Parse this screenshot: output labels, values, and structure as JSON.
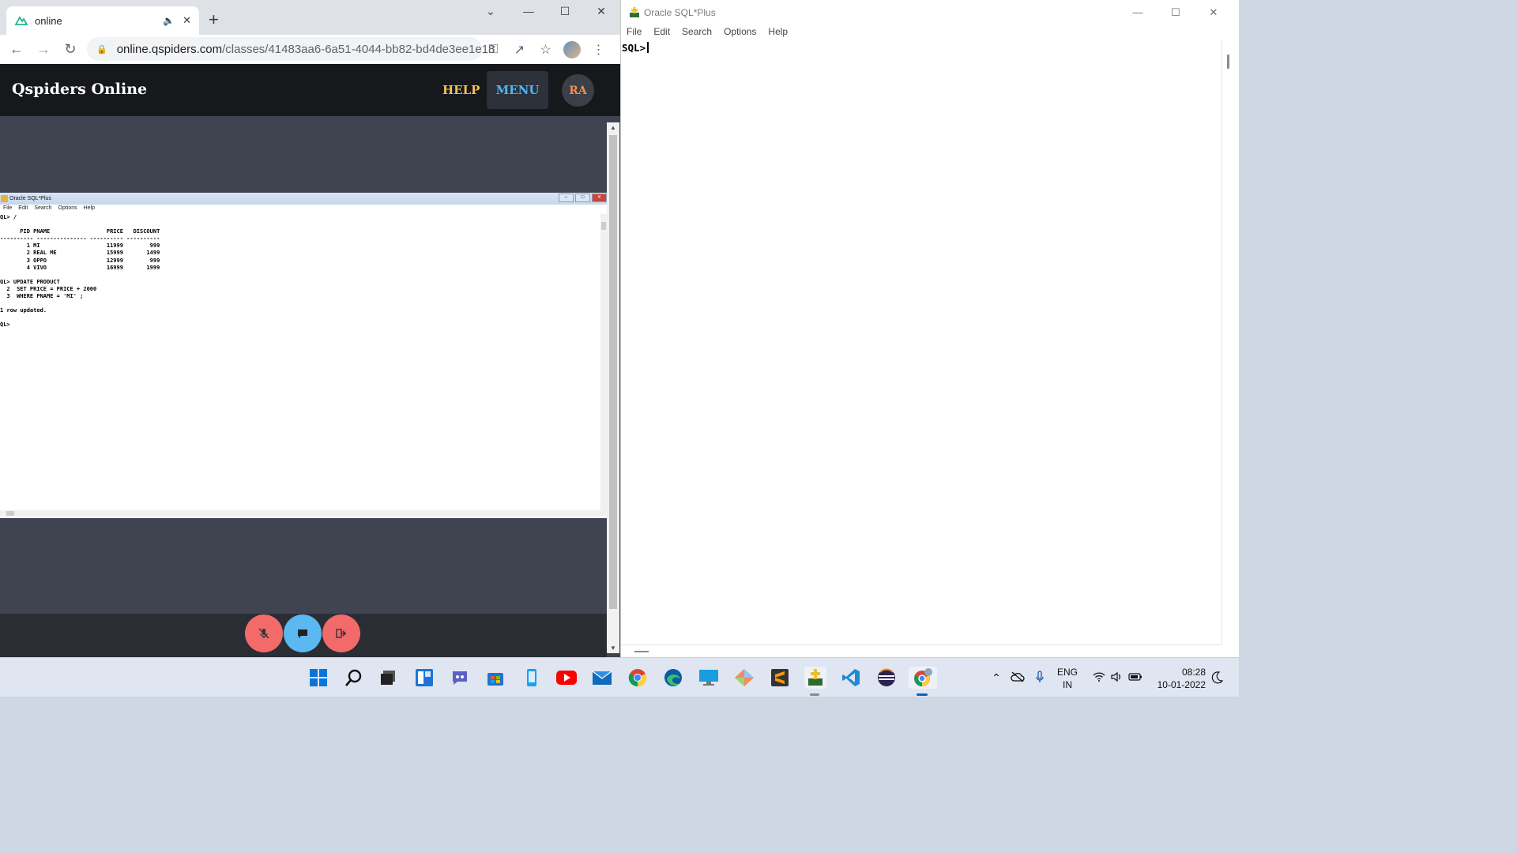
{
  "chrome": {
    "tab_title": "online",
    "url_host": "online.qspiders.com",
    "url_path": "/classes/41483aa6-6a51-4044-bb82-bd4de3ee1e18"
  },
  "site": {
    "brand": "Qspiders Online",
    "help": "HELP",
    "menu": "MENU",
    "avatar": "RA"
  },
  "shared_screen": {
    "title": "Oracle SQL*Plus",
    "menu": [
      "File",
      "Edit",
      "Search",
      "Options",
      "Help"
    ],
    "console_lines": [
      "QL> /",
      "",
      "      PID PNAME                 PRICE   DISCOUNT",
      "---------- --------------- ---------- ----------",
      "        1 MI                    11999        999",
      "        2 REAL ME               15999       1499",
      "        3 OPPO                  12999        999",
      "        4 VIVO                  16999       1999",
      "",
      "QL> UPDATE PRODUCT",
      "  2  SET PRICE = PRICE + 2000",
      "  3  WHERE PNAME = 'MI' ;",
      "",
      "1 row updated.",
      "",
      "QL>"
    ]
  },
  "sqlplus": {
    "title": "Oracle SQL*Plus",
    "menu": [
      "File",
      "Edit",
      "Search",
      "Options",
      "Help"
    ],
    "prompt": "SQL>"
  },
  "taskbar": {
    "apps": [
      "start",
      "search",
      "task-view",
      "widgets",
      "teams-chat",
      "microsoft-store",
      "file-explorer",
      "youtube",
      "mail",
      "chrome",
      "edge",
      "remote-desktop",
      "git",
      "sublime-text",
      "oracle-sqlplus",
      "vscode",
      "eclipse",
      "chrome-profile"
    ],
    "lang_line1": "ENG",
    "lang_line2": "IN",
    "time": "08:28",
    "date": "10-01-2022"
  },
  "colors": {
    "help": "#f2c14e",
    "menu": "#4fb6f5",
    "avatar": "#f28b52",
    "mute_button": "#f26a6a",
    "chat_button": "#5bb8f0",
    "leave_button": "#f26a6a"
  }
}
